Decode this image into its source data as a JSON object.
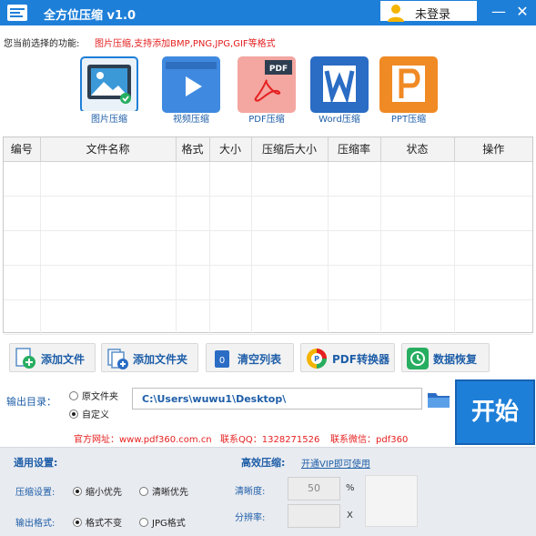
{
  "window": {
    "title": "全方位压缩 v1.0",
    "login_label": "未登录",
    "minimize_glyph": "—",
    "close_glyph": "✕"
  },
  "function": {
    "label": "您当前选择的功能:",
    "description": "图片压缩,支持添加BMP,PNG,JPG,GIF等格式",
    "tools": [
      {
        "label": "图片压缩",
        "icon": "image-compress-icon",
        "selected": true
      },
      {
        "label": "视频压缩",
        "icon": "video-compress-icon",
        "selected": false
      },
      {
        "label": "PDF压缩",
        "icon": "pdf-compress-icon",
        "selected": false
      },
      {
        "label": "Word压缩",
        "icon": "word-compress-icon",
        "selected": false
      },
      {
        "label": "PPT压缩",
        "icon": "ppt-compress-icon",
        "selected": false
      }
    ]
  },
  "table": {
    "columns": [
      "编号",
      "文件名称",
      "格式",
      "大小",
      "压缩后大小",
      "压缩率",
      "状态",
      "操作"
    ],
    "rows": []
  },
  "actions": [
    {
      "label": "添加文件",
      "icon": "add-file-icon"
    },
    {
      "label": "添加文件夹",
      "icon": "add-folder-icon"
    },
    {
      "label": "清空列表",
      "icon": "clear-list-icon"
    },
    {
      "label": "PDF转换器",
      "icon": "pdf-converter-icon"
    },
    {
      "label": "数据恢复",
      "icon": "data-recovery-icon"
    }
  ],
  "output": {
    "label": "输出目录：",
    "option_original": "原文件夹",
    "option_custom": "自定义",
    "selected": "自定义",
    "path": "C:\\Users\\wuwu1\\Desktop\\",
    "start_label": "开始"
  },
  "contact": {
    "website": "官方网址：www.pdf360.com.cn",
    "qq": "联系QQ：1328271526",
    "wechat": "联系微信：pdf360"
  },
  "settings": {
    "general_title": "通用设置:",
    "efficient_title": "高效压缩:",
    "vip_link": "开通VIP即可使用",
    "compress_label": "压缩设置:",
    "compress_opt1": "缩小优先",
    "compress_opt2": "清晰优先",
    "format_label": "输出格式:",
    "format_opt1": "格式不变",
    "format_opt2": "JPG格式",
    "clarity_label": "清晰度:",
    "clarity_value": "50",
    "clarity_unit": "%",
    "resolution_label": "分辨率:",
    "resolution_unit": "X"
  },
  "colors": {
    "accent": "#1e7fd8",
    "link": "#1e5ea8",
    "warning": "#e52020"
  }
}
